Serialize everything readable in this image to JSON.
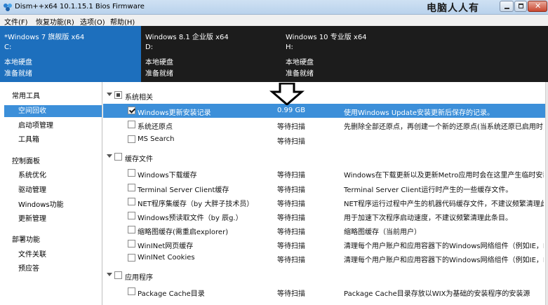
{
  "window": {
    "title": "Dism++x64 10.1.15.1 Bios Firmware",
    "watermark": "电脑人人有"
  },
  "menu": [
    "文件(F)",
    "恢复功能(R)",
    "选项(O)",
    "帮助(H)"
  ],
  "images": [
    {
      "name": "*Windows 7 旗舰版 x64",
      "drive": "C:",
      "type": "本地硬盘",
      "status": "准备就绪",
      "active": true
    },
    {
      "name": "Windows 8.1 企业版 x64",
      "drive": "D:",
      "type": "本地硬盘",
      "status": "准备就绪",
      "active": false
    },
    {
      "name": "Windows 10 专业版 x64",
      "drive": "H:",
      "type": "本地硬盘",
      "status": "准备就绪",
      "active": false
    }
  ],
  "sidebar": {
    "groups": [
      {
        "label": "常用工具",
        "items": [
          "空间回收",
          "启动项管理",
          "工具箱"
        ]
      },
      {
        "label": "控制面板",
        "items": [
          "系统优化",
          "驱动管理",
          "Windows功能",
          "更新管理"
        ]
      },
      {
        "label": "部署功能",
        "items": [
          "文件关联",
          "预应答"
        ]
      }
    ],
    "selected": "空间回收"
  },
  "cleanup": {
    "categories": [
      {
        "label": "系统相关",
        "items": [
          {
            "name": "Windows更新安装记录",
            "size": "0.99 GB",
            "desc": "使用Windows Update安装更新后保存的记录。",
            "checked": true,
            "selected": true
          },
          {
            "name": "系统还原点",
            "size": "等待扫描",
            "desc": "先删除全部还原点，再创建一个新的还原点(当系统还原已启用时)",
            "checked": false,
            "selected": false
          },
          {
            "name": "MS Search",
            "size": "等待扫描",
            "desc": "",
            "checked": false,
            "selected": false
          }
        ]
      },
      {
        "label": "缓存文件",
        "items": [
          {
            "name": "Windows下载缓存",
            "size": "等待扫描",
            "desc": "Windows在下载更新以及更新Metro应用时会在这里产生临时安装",
            "checked": false,
            "selected": false
          },
          {
            "name": "Terminal Server Client缓存",
            "size": "等待扫描",
            "desc": "Terminal Server Client运行时产生的一些缓存文件。",
            "checked": false,
            "selected": false
          },
          {
            "name": "NET程序集缓存（by 大胖子技术员）",
            "size": "等待扫描",
            "desc": "NET程序运行过程中产生的机器代码缓存文件，不建议频繁清理此缓",
            "checked": false,
            "selected": false
          },
          {
            "name": "Windows预读取文件（by 辰g.）",
            "size": "等待扫描",
            "desc": "用于加速下次程序启动速度，不建议频繁清理此条目。",
            "checked": false,
            "selected": false
          },
          {
            "name": "缩略图缓存(需重启explorer)",
            "size": "等待扫描",
            "desc": "缩略图缓存（当前用户）",
            "checked": false,
            "selected": false
          },
          {
            "name": "WinINet网页缓存",
            "size": "等待扫描",
            "desc": "清理每个用户账户和应用容器下的Windows网络组件（例如IE，Ed",
            "checked": false,
            "selected": false
          },
          {
            "name": "WinINet Cookies",
            "size": "等待扫描",
            "desc": "清理每个用户账户和应用容器下的Windows网络组件（例如IE，Ed",
            "checked": false,
            "selected": false
          }
        ]
      },
      {
        "label": "应用程序",
        "items": [
          {
            "name": "Package Cache目录",
            "size": "等待扫描",
            "desc": "Package Cache目录存放以WIX为基础的安装程序的安装源",
            "checked": false,
            "selected": false
          }
        ]
      }
    ]
  },
  "icons": {
    "app": "dism-app-icon",
    "annotation": "down-arrow-annotation-icon"
  },
  "colors": {
    "accent": "#1d6fbd",
    "selection": "#3c8fd9",
    "tile_bg": "#1c1c1c"
  }
}
